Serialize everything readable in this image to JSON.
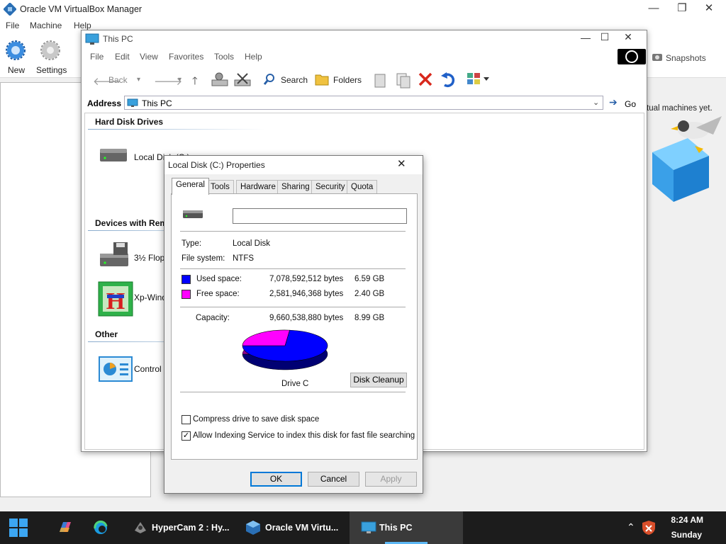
{
  "virtualbox": {
    "title": "Oracle VM VirtualBox Manager",
    "menu": [
      "File",
      "Machine",
      "Help"
    ],
    "tools": {
      "new": "New",
      "settings": "Settings"
    },
    "snapshots": "Snapshots",
    "empty_message": "tual machines yet."
  },
  "explorer": {
    "title": "This PC",
    "menu": [
      "File",
      "Edit",
      "View",
      "Favorites",
      "Tools",
      "Help"
    ],
    "toolbar": {
      "back": "Back",
      "search": "Search",
      "folders": "Folders"
    },
    "address_label": "Address",
    "address_value": "This PC",
    "go_label": "Go",
    "groups": {
      "hard_disk": "Hard Disk Drives",
      "removable": "Devices with Rem",
      "other": "Other"
    },
    "items": {
      "local_disk": "Local Disk (C:)",
      "floppy": "3½ Flop",
      "xp_windows": "Xp-Wind",
      "control_panel": "Control"
    }
  },
  "dialog": {
    "title": "Local Disk (C:) Properties",
    "tabs": [
      "General",
      "Tools",
      "Hardware",
      "Sharing",
      "Security",
      "Quota"
    ],
    "active_tab": "General",
    "name_value": "",
    "type_label": "Type:",
    "type_value": "Local Disk",
    "fs_label": "File system:",
    "fs_value": "NTFS",
    "used_label": "Used space:",
    "used_bytes": "7,078,592,512 bytes",
    "used_gb": "6.59 GB",
    "free_label": "Free space:",
    "free_bytes": "2,581,946,368 bytes",
    "free_gb": "2.40 GB",
    "capacity_label": "Capacity:",
    "capacity_bytes": "9,660,538,880 bytes",
    "capacity_gb": "8.99 GB",
    "used_fraction": 0.7327,
    "used_color": "#0000ff",
    "free_color": "#ff00ff",
    "drive_label": "Drive C",
    "cleanup_button": "Disk Cleanup",
    "compress_label": "Compress drive to save disk space",
    "compress_checked": false,
    "index_label": "Allow Indexing Service to index this disk for fast file searching",
    "index_checked": true,
    "ok": "OK",
    "cancel": "Cancel",
    "apply": "Apply"
  },
  "taskbar": {
    "apps": [
      "HyperCam 2 : Hy...",
      "Oracle VM Virtu...",
      "This PC"
    ],
    "active": "This PC",
    "time": "8:24 AM",
    "day": "Sunday"
  }
}
